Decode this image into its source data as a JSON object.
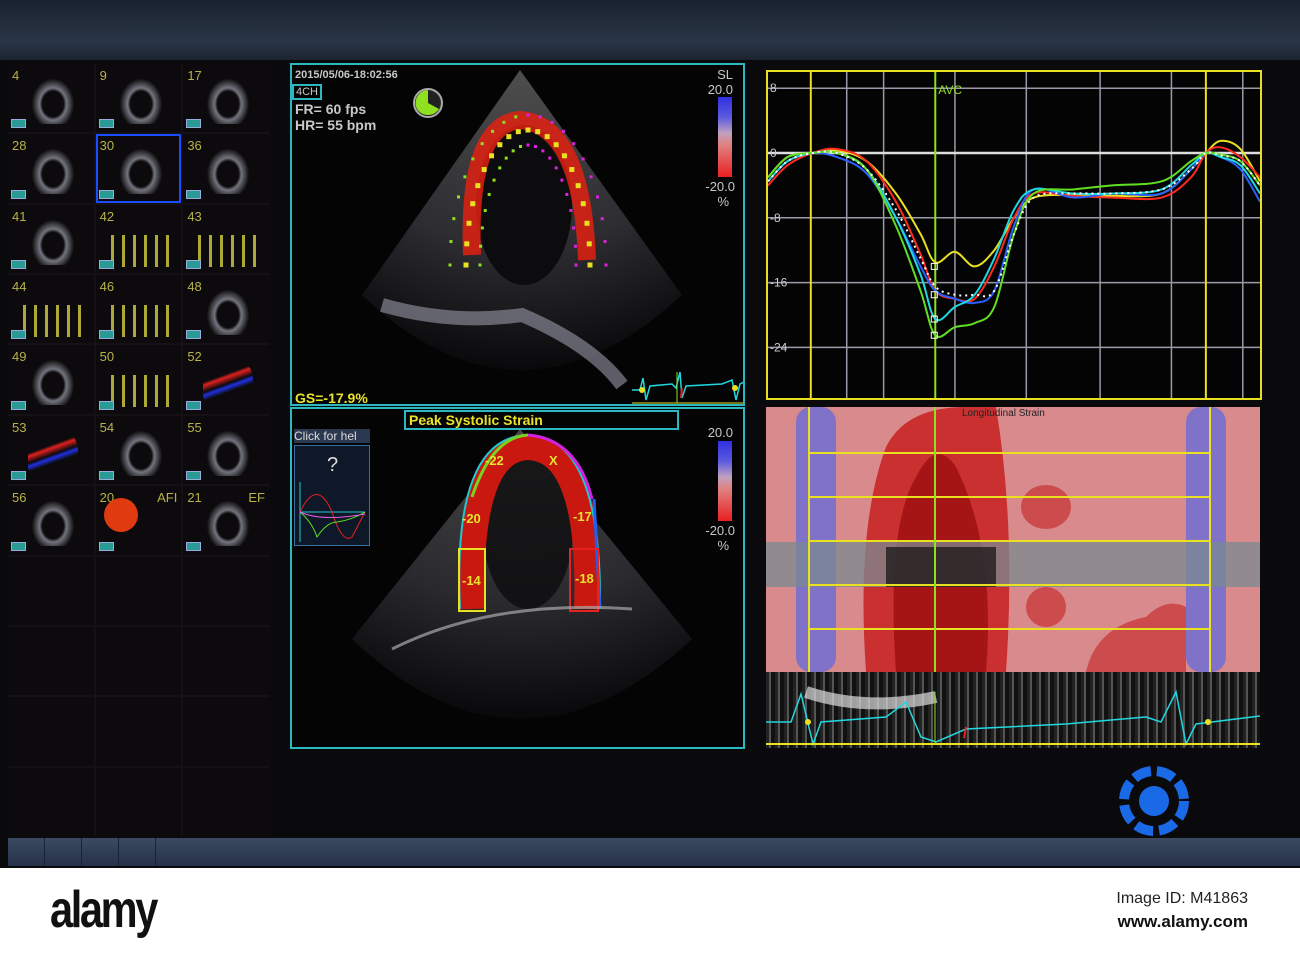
{
  "thumbnails": [
    {
      "label": "4",
      "kind": "echo"
    },
    {
      "label": "9",
      "kind": "echo"
    },
    {
      "label": "17",
      "kind": "echo"
    },
    {
      "label": "28",
      "kind": "echo"
    },
    {
      "label": "30",
      "kind": "echo",
      "selected": true
    },
    {
      "label": "36",
      "kind": "echo"
    },
    {
      "label": "41",
      "kind": "echo"
    },
    {
      "label": "42",
      "kind": "doppler"
    },
    {
      "label": "43",
      "kind": "doppler"
    },
    {
      "label": "44",
      "kind": "doppler"
    },
    {
      "label": "46",
      "kind": "doppler"
    },
    {
      "label": "48",
      "kind": "echo"
    },
    {
      "label": "49",
      "kind": "echo"
    },
    {
      "label": "50",
      "kind": "doppler"
    },
    {
      "label": "52",
      "kind": "color"
    },
    {
      "label": "53",
      "kind": "color"
    },
    {
      "label": "54",
      "kind": "echo"
    },
    {
      "label": "55",
      "kind": "echo"
    },
    {
      "label": "56",
      "kind": "echo"
    },
    {
      "label": "20",
      "tag": "AFI",
      "kind": "bullseye"
    },
    {
      "label": "21",
      "tag": "EF",
      "kind": "echo"
    }
  ],
  "top_view": {
    "timestamp": "2015/05/06-18:02:56",
    "view": "4CH",
    "frame_rate": "FR= 60 fps",
    "heart_rate": "HR= 55 bpm",
    "scale_mode": "SL",
    "scale_max": "20.0",
    "scale_min": "-20.0",
    "scale_unit": "%",
    "global_strain": "GS=-17.9%"
  },
  "bottom_view": {
    "title": "Peak Systolic Strain",
    "help_button": "Click for hel",
    "help_icon": "?",
    "scale_max": "20.0",
    "scale_min": "-20.0",
    "scale_unit": "%",
    "segments": [
      {
        "label": "-22",
        "color": "#7ad020"
      },
      {
        "label": "X",
        "color": "#d020e0"
      },
      {
        "label": "-20",
        "color": "#20c8d0"
      },
      {
        "label": "-17",
        "color": "#2060f0"
      },
      {
        "label": "-14",
        "color": "#e8e020"
      },
      {
        "label": "-18",
        "color": "#e82020"
      }
    ]
  },
  "chart_data": {
    "type": "line",
    "title": "",
    "annotation": "AVC",
    "yticks": [
      "8",
      "0",
      "-8",
      "-16",
      "-24"
    ],
    "ylim": [
      -28,
      10
    ],
    "xlim": [
      0,
      100
    ],
    "x": [
      0,
      4,
      9,
      14,
      20,
      26,
      31,
      34,
      38,
      42,
      46,
      50,
      54,
      62,
      70,
      80,
      86,
      89,
      92,
      96,
      100
    ],
    "series": [
      {
        "name": "yellow",
        "color": "#e8e020",
        "values": [
          -3,
          -0.5,
          0,
          0.3,
          -1,
          -5,
          -10,
          -13.5,
          -12.2,
          -14,
          -12,
          -8,
          -5.5,
          -5.2,
          -5.3,
          -5,
          -2,
          0,
          1.5,
          0.5,
          -3.5
        ]
      },
      {
        "name": "red",
        "color": "#ff2a20",
        "values": [
          -4,
          -1.5,
          0,
          0.5,
          -1,
          -6,
          -12.5,
          -17,
          -18,
          -18,
          -14,
          -8,
          -5,
          -5.3,
          -5.5,
          -5.5,
          -3,
          0,
          0.7,
          -0.5,
          -3
        ]
      },
      {
        "name": "blue",
        "color": "#2a60ff",
        "values": [
          -3.5,
          -1,
          0,
          -0.5,
          -2.5,
          -8,
          -14,
          -17,
          -18,
          -18.5,
          -17,
          -9,
          -4.5,
          -5.5,
          -5,
          -5,
          -2,
          0,
          -0.5,
          -2,
          -6
        ]
      },
      {
        "name": "cyan",
        "color": "#20d8e0",
        "values": [
          -3.5,
          -1,
          0,
          0,
          -2,
          -8,
          -15,
          -20.5,
          -19,
          -17.5,
          -13,
          -7,
          -4.5,
          -5,
          -5,
          -4.5,
          -1.5,
          0,
          -0.5,
          -1.5,
          -5
        ]
      },
      {
        "name": "green",
        "color": "#60e020",
        "values": [
          -3,
          -0.5,
          0,
          0,
          -2,
          -9,
          -17,
          -22.5,
          -21.5,
          -21,
          -19,
          -10,
          -5,
          -4.5,
          -4,
          -3.5,
          -1,
          0,
          -0.2,
          -1,
          -4
        ]
      },
      {
        "name": "average",
        "color": "#ffffff",
        "dotted": true,
        "values": [
          -3.5,
          -1,
          0,
          0,
          -2,
          -7,
          -13,
          -16.5,
          -17.5,
          -17.5,
          -17,
          -10,
          -5.5,
          -5,
          -5,
          -4.5,
          -2,
          0,
          -0.3,
          -1,
          -4
        ]
      }
    ],
    "markers": {
      "avc": 34,
      "cycle_start": 8.7,
      "cycle_end": 89
    }
  },
  "heatmap": {
    "title": "Longitudinal Strain"
  },
  "footer": {
    "logo": "alamy",
    "image_id": "Image ID: M41863",
    "url": "www.alamy.com"
  },
  "colors": {
    "frame": "#2bb8c0",
    "label": "#e8e22a",
    "selection": "#1a4dff"
  }
}
